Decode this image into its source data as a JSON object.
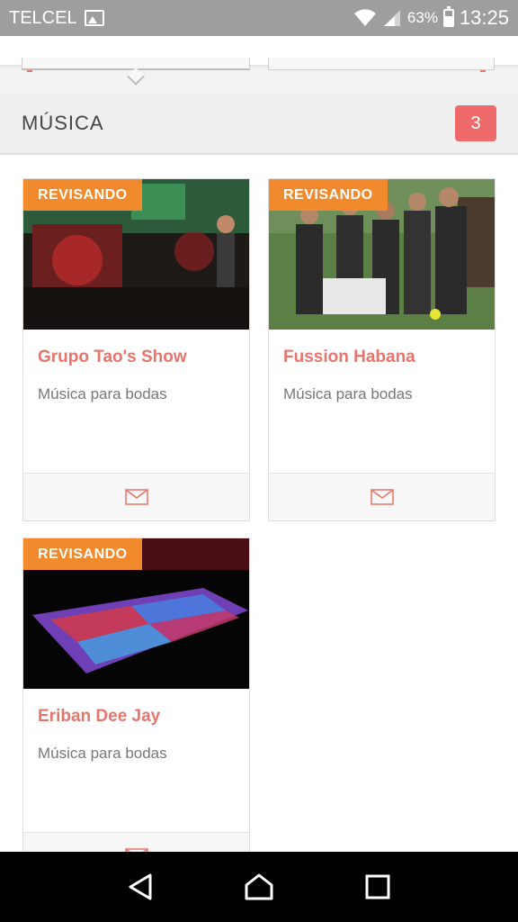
{
  "status_bar": {
    "carrier": "TELCEL",
    "battery_percent": "63%",
    "time": "13:25",
    "icons": [
      "image-icon",
      "wifi-icon",
      "signal-icon",
      "battery-icon"
    ]
  },
  "section": {
    "title": "MÚSICA",
    "count": "3"
  },
  "cards": [
    {
      "status": "REVISANDO",
      "title": "Grupo Tao's Show",
      "subtitle": "Música para bodas",
      "image": "band-stage-photo"
    },
    {
      "status": "REVISANDO",
      "title": "Fussion Habana",
      "subtitle": "Música para bodas",
      "image": "band-group-photo"
    },
    {
      "status": "REVISANDO",
      "title": "Eriban Dee Jay",
      "subtitle": "Música para bodas",
      "image": "led-dance-floor-photo"
    }
  ],
  "colors": {
    "accent": "#e8756b",
    "status_tag": "#f08a2c",
    "badge": "#ef6b6b",
    "status_bar": "#9e9e9e",
    "nav_bar": "#000000"
  },
  "nav_bar": {
    "buttons": [
      "back-icon",
      "home-icon",
      "recents-icon"
    ]
  }
}
